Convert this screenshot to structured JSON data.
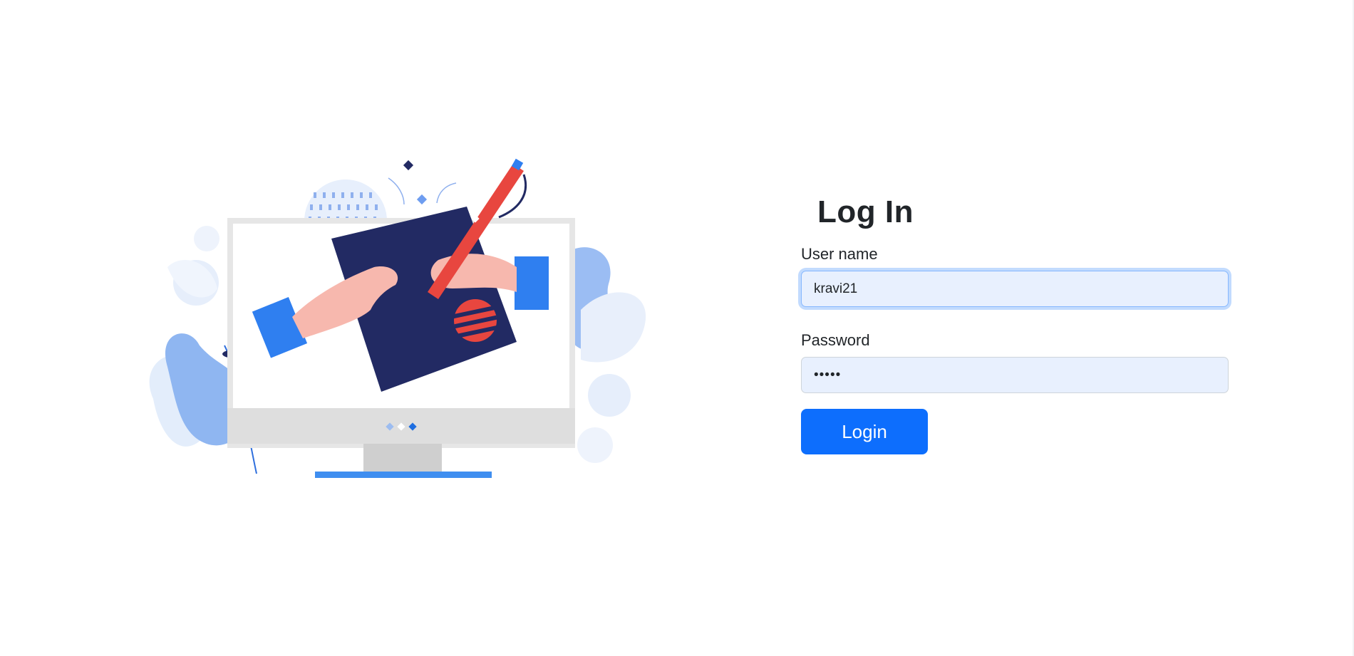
{
  "login": {
    "title": "Log In",
    "username_label": "User name",
    "username_value": "kravi21",
    "password_label": "Password",
    "password_value": "•••••",
    "button_label": "Login"
  },
  "colors": {
    "primary": "#0d6efd",
    "navy": "#222a63",
    "coral": "#e8463f",
    "light_blue": "#a8c7f5",
    "input_bg": "#e8f0fe"
  },
  "illustration": {
    "icon": "designer-drawing-on-monitor-illustration"
  }
}
